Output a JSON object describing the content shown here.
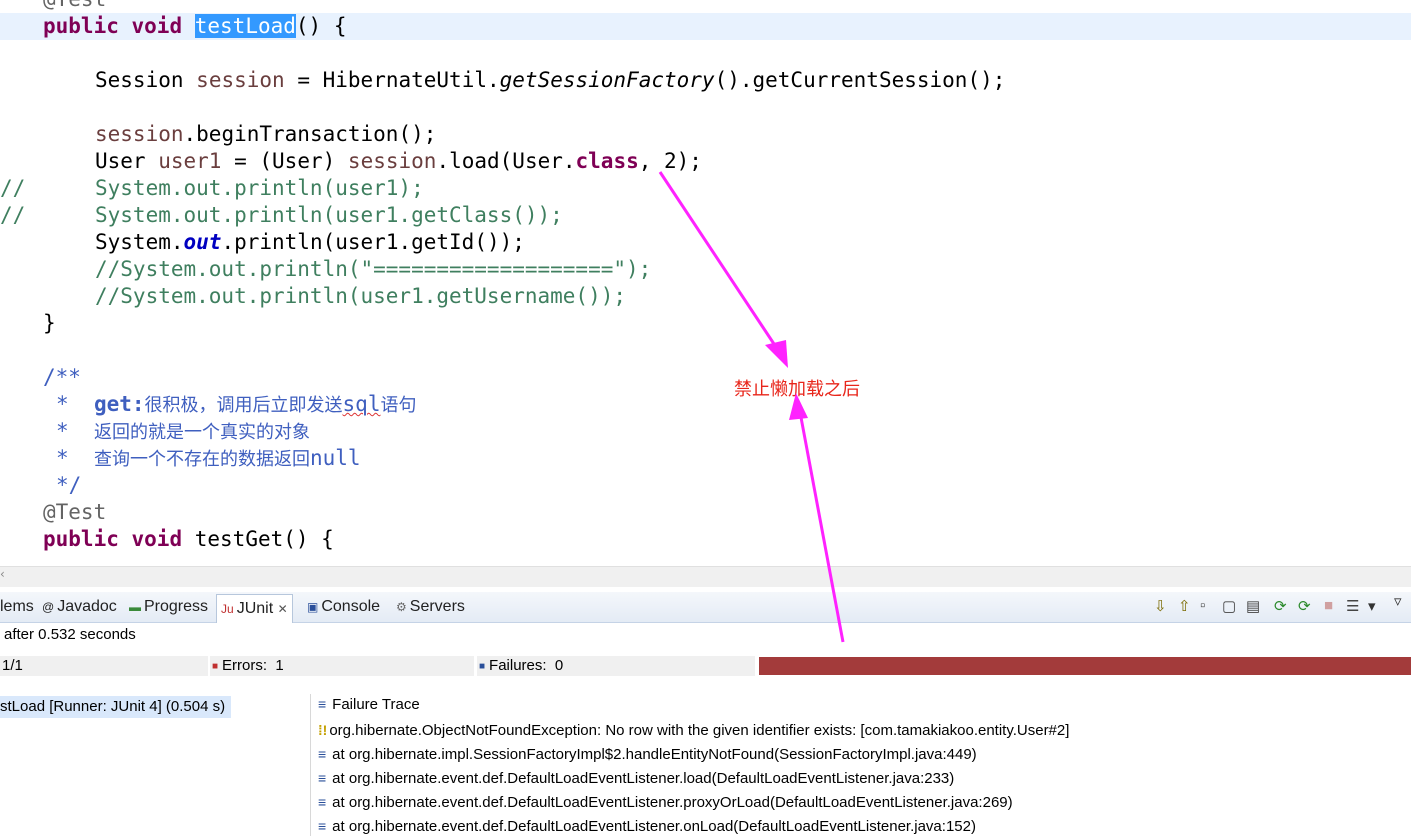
{
  "editor": {
    "line0": "@Test",
    "l1_kw1": "public",
    "l1_kw2": "void",
    "l1_sel": "testLoad",
    "l1_rest": "() {",
    "l2_type": "Session",
    "l2_var": "session",
    "l2_mid": "= HibernateUtil.",
    "l2_it": "getSessionFactory",
    "l2_end": "().getCurrentSession();",
    "l3_var": "session",
    "l3_rest": ".beginTransaction();",
    "l4_type": "User",
    "l4_var1": "user1",
    "l4_mid": "= (User)",
    "l4_var2": "session",
    "l4_mid2": ".load(User.",
    "l4_kw": "class",
    "l4_end": ", 2);",
    "l5_marker": "//",
    "l5": "System.out.println(user1);",
    "l6_marker": "//",
    "l6": "System.out.println(user1.getClass());",
    "l7_a": "System.",
    "l7_fld": "out",
    "l7_b": ".println(user1.getId());",
    "l8": "//System.out.println(\"===================\");",
    "l9": "//System.out.println(user1.getUsername());",
    "l10": "}",
    "l11": "/**",
    "l12_star": "*",
    "l12_tag": "get:",
    "l12_cn1": "很积极，调用后立即发送",
    "l12_sql": "sql",
    "l12_cn2": "语句",
    "l13_star": "*",
    "l13_cn": "返回的就是一个真实的对象",
    "l14_star": "*",
    "l14_cn": "查询一个不存在的数据返回",
    "l14_null": "null",
    "l15": "*/",
    "l16": "@Test",
    "l17_kw1": "public",
    "l17_kw2": "void",
    "l17_rest": "testGet() {"
  },
  "annotation": {
    "text": "禁止懒加载之后",
    "color": "#e8261b",
    "arrow_color": "#ff22ff"
  },
  "panel": {
    "tabs": {
      "problems": "lems",
      "javadoc": "Javadoc",
      "progress": "Progress",
      "junit": "JUnit",
      "console": "Console",
      "servers": "Servers"
    },
    "status": "after 0.532 seconds",
    "runs": "1/1",
    "errors_label": "Errors:",
    "errors_value": "1",
    "failures_label": "Failures:",
    "failures_value": "0",
    "progress_color": "#a33b3b",
    "test_item": "stLoad [Runner: JUnit 4] (0.504 s)",
    "trace_header": "Failure Trace",
    "trace": [
      "org.hibernate.ObjectNotFoundException: No row with the given identifier exists: [com.tamakiakoo.entity.User#2]",
      "at org.hibernate.impl.SessionFactoryImpl$2.handleEntityNotFound(SessionFactoryImpl.java:449)",
      "at org.hibernate.event.def.DefaultLoadEventListener.load(DefaultLoadEventListener.java:233)",
      "at org.hibernate.event.def.DefaultLoadEventListener.proxyOrLoad(DefaultLoadEventListener.java:269)",
      "at org.hibernate.event.def.DefaultLoadEventListener.onLoad(DefaultLoadEventListener.java:152)"
    ]
  }
}
